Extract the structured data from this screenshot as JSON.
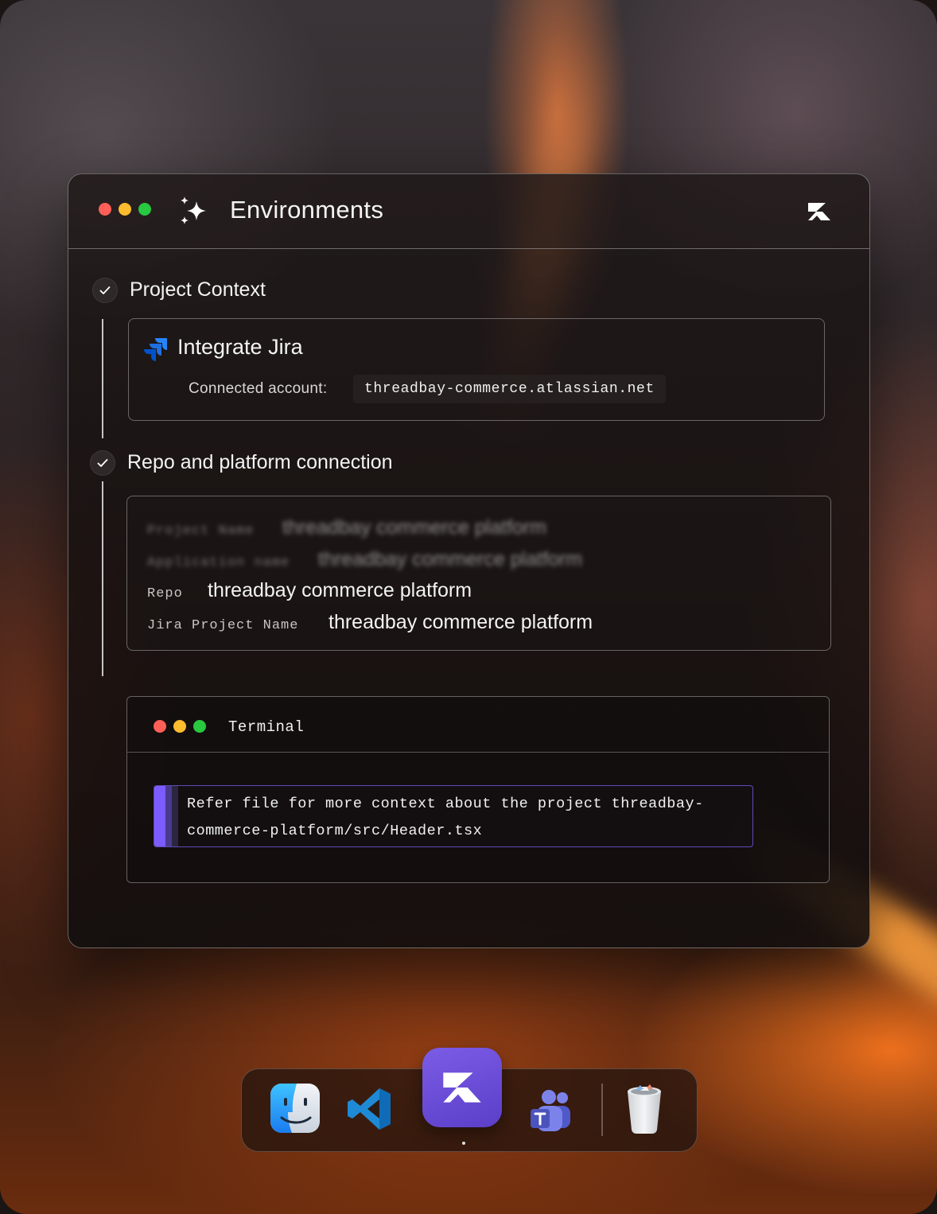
{
  "window": {
    "title": "Environments"
  },
  "steps": [
    {
      "title": "Project Context",
      "card": {
        "title": "Integrate Jira",
        "connected_label": "Connected account:",
        "connected_value": "threadbay-commerce.atlassian.net"
      }
    },
    {
      "title": "Repo and platform connection",
      "fields": [
        {
          "key": "Project Name",
          "value": "threadbay commerce platform",
          "blurred": true
        },
        {
          "key": "Application name",
          "value": "threadbay commerce platform",
          "blurred": true
        },
        {
          "key": "Repo",
          "value": "threadbay commerce platform",
          "blurred": false
        },
        {
          "key": "Jira Project Name",
          "value": "threadbay commerce platform",
          "blurred": false
        }
      ]
    }
  ],
  "terminal": {
    "title": "Terminal",
    "message_line1": "Refer file for more context about the project threadbay-",
    "message_line2": "commerce-platform/src/Header.tsx"
  },
  "dock": {
    "apps": [
      "finder-icon",
      "vscode-icon",
      "app-logo-icon",
      "teams-icon",
      "trash-icon"
    ],
    "active": "app-logo-icon"
  },
  "colors": {
    "accent": "#7b5cff",
    "traffic_red": "#ff5f57",
    "traffic_yellow": "#febc2e",
    "traffic_green": "#28c840"
  }
}
